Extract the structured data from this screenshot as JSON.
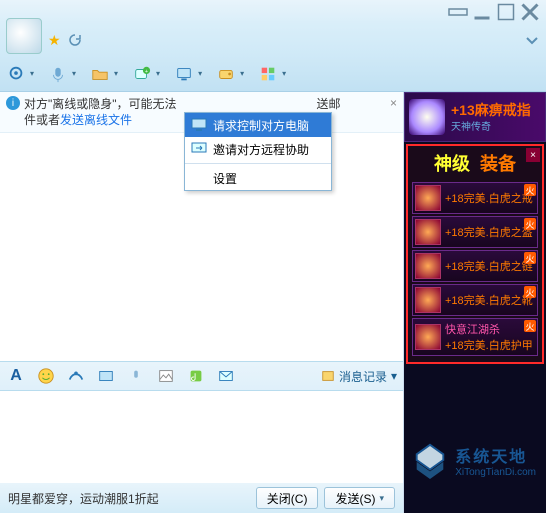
{
  "window": {
    "dropdown_icon": "▾"
  },
  "notice": {
    "before": "对方\"离线或隐身\"，可能无法",
    "tail": "送邮",
    "line2_before": "件或者",
    "link": "发送离线文件"
  },
  "menu": {
    "item1": "请求控制对方电脑",
    "item2": "邀请对方远程协助",
    "item3": "设置"
  },
  "editor": {
    "history": "消息记录"
  },
  "bottom": {
    "tip": "明星都爱穿，运动潮服1折起",
    "close": "关闭(C)",
    "send": "发送(S)"
  },
  "ad": {
    "top_title": "+13麻痹戒指",
    "top_sub": "天神传奇",
    "panel_a": "神级",
    "panel_b": "装备",
    "items": [
      "+18完美.白虎之戒",
      "+18完美.白虎之盔",
      "+18完美.白虎之链",
      "+18完美.白虎之靴",
      "+18完美.白虎护甲"
    ],
    "subline": "快意江湖杀",
    "fire": "火"
  },
  "watermark": {
    "title": "系统天地",
    "url": "XiTongTianDi.com"
  }
}
